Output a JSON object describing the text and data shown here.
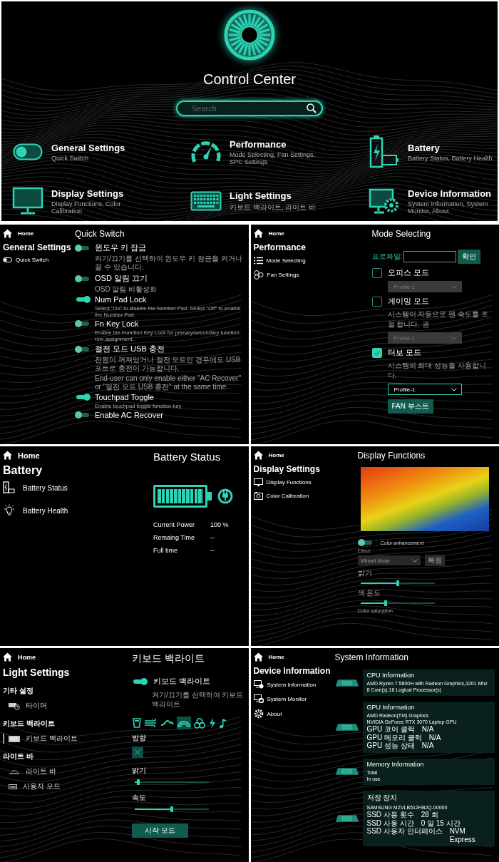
{
  "hero": {
    "title": "Control Center",
    "search": {
      "placeholder": "Search"
    },
    "categories": [
      {
        "title": "General Settings",
        "subtitle": "Quick Switch"
      },
      {
        "title": "Performance",
        "subtitle": "Mode Selecting, Fan Settings, SPC Settings"
      },
      {
        "title": "Battery",
        "subtitle": "Battery Status, Battery Health"
      },
      {
        "title": "Display Settings",
        "subtitle": "Display Functions, Color Calibration"
      },
      {
        "title": "Light Settings",
        "subtitle": "키보드 백라이트, 라이트 바"
      },
      {
        "title": "Device Information",
        "subtitle": "System Information, System Monitor, About"
      }
    ]
  },
  "general": {
    "home": "Home",
    "title": "General Settings",
    "nav": [
      "Quick Switch"
    ],
    "heading": "Quick Switch",
    "switches": [
      {
        "label": "윈도우 키 잠금",
        "on": false,
        "description": [
          "켜기/끄기를 선택하여 윈도우 키 잠금을 켜거나 끌 수 있습니다."
        ]
      },
      {
        "label": "OSD 알림 끄기",
        "on": false,
        "description": [
          "OSD 알림 비활성화"
        ]
      },
      {
        "label": "Num Pad Lock",
        "on": true,
        "description": [
          "Select \"On\" to disable the Number Pad. Select \"Off\" to enable the Number Pad."
        ]
      },
      {
        "label": "Fn Key Lock",
        "on": false,
        "description": [
          "Enable the Function Key Lock for primary/secondary function row assignment."
        ]
      },
      {
        "label": "절전 모드 USB 충전",
        "on": false,
        "description": [
          "전원이 꺼져있거나 절전 모드인 경우에도 USB 포트로 충전이 가능합니다.",
          "End-user can only enable either \"AC Recover\" or \"절전 모드 USB 충전\" at the same time."
        ]
      },
      {
        "label": "Touchpad Toggle",
        "on": true,
        "description": [
          "Enable touchpad toggle function-key"
        ]
      },
      {
        "label": "Enable AC Recover",
        "on": false
      }
    ]
  },
  "performance": {
    "home": "Home",
    "title": "Performance",
    "nav": [
      "Mode Selecting",
      "Fan Settings"
    ],
    "heading": "Mode Selecting",
    "profile": {
      "label": "프로파일:",
      "button": "확인"
    },
    "modes": [
      {
        "label": "오피스 모드",
        "checked": false,
        "dropdown": "Profile-1",
        "disabled": true
      },
      {
        "label": "게이밍 모드",
        "checked": false,
        "description": "시스템이 자동으로 팬 속도를 조절 합니다. 권",
        "dropdown": "Profile-1",
        "disabled": true
      },
      {
        "label": "터보 모드",
        "checked": true,
        "description": "시스템의 최대 성능을 사용합니다.",
        "dropdown": "Profile-1",
        "disabled": false
      }
    ],
    "button": "FAN 부스트"
  },
  "battery": {
    "home": "Home",
    "title": "Battery",
    "nav": [
      "Battery Status",
      "Battery Health"
    ],
    "heading": "Battery Status",
    "level": 1,
    "rows": [
      {
        "label": "Current Power",
        "value": "100 %"
      },
      {
        "label": "Remaing Time",
        "value": "--"
      },
      {
        "label": "Full time",
        "value": "--"
      }
    ]
  },
  "display": {
    "home": "Home",
    "title": "Display Settings",
    "nav": [
      "Display Functions",
      "Color Calibration"
    ],
    "heading": "Display Functions",
    "enhancement": {
      "label": "Color enhancement",
      "on": false
    },
    "effect": {
      "label": "Effect",
      "value": "Vibrant Mode",
      "button": "복원",
      "disabled": true
    },
    "sliders": [
      {
        "label": "밝기",
        "level": 0.5
      },
      {
        "label": "색 온도",
        "level": 0.33
      }
    ],
    "footer": "Color saturation"
  },
  "light": {
    "home": "Home",
    "title": "Light Settings",
    "groups": [
      {
        "heading": "기타 설정",
        "items": [
          {
            "label": "타이머",
            "selected": false
          }
        ]
      },
      {
        "heading": "키보드 백라이트",
        "items": [
          {
            "label": "키보드 백라이트",
            "selected": true
          }
        ]
      },
      {
        "heading": "라이트 바",
        "items": [
          {
            "label": "라이트 바",
            "selected": false
          },
          {
            "label": "사용자 모드",
            "selected": false
          }
        ]
      }
    ],
    "heading": "키보드 백라이트",
    "backlight": {
      "label": "키보드 백라이트",
      "on": true,
      "description": "켜기/끄기를 선택하여 키보드 백라이트"
    },
    "effects": [
      {
        "selected": false
      },
      {
        "selected": false
      },
      {
        "selected": false
      },
      {
        "selected": true
      },
      {
        "selected": false
      },
      {
        "selected": false
      },
      {
        "selected": false
      }
    ],
    "direction": "방향",
    "sliders": [
      {
        "label": "밝기",
        "level": 0.03
      },
      {
        "label": "속도",
        "level": 0.5
      }
    ],
    "button": "시작 모드"
  },
  "device": {
    "home": "Home",
    "title": "Device Information",
    "nav": [
      "System Information",
      "System Monitor",
      "About"
    ],
    "heading": "System Information",
    "cards": [
      {
        "title": "CPU Information",
        "lines": [
          "AMD Ryzen 7 5800H with Radeon Graphics,3201 Mhz",
          "8 Core(s),16 Logical Processor(s)"
        ]
      },
      {
        "title": "GPU Information",
        "lines": [
          "AMD Radeon(TM) Graphics",
          "NVIDIA GeForce RTX 3070 Laptop GPU"
        ],
        "rows": [
          {
            "label": "GPU 코어 클럭",
            "value": "N/A"
          },
          {
            "label": "GPU 메모리 클럭",
            "value": "N/A"
          },
          {
            "label": "GPU 성능 상태",
            "value": "N/A"
          }
        ]
      },
      {
        "title": "Memory Information",
        "lines": [
          "Total",
          "In use"
        ]
      },
      {
        "title": "저장 장치",
        "lines": [
          "SAMSUNG MZVLB512HBJQ-00000"
        ],
        "rows": [
          {
            "label": "SSD 사용 횟수",
            "value": "28 회"
          },
          {
            "label": "SSD 사용 시간",
            "value": "0 일 15 시간"
          },
          {
            "label": "SSD 사용자 인터페이스",
            "value": "NVM Express"
          }
        ]
      }
    ]
  }
}
